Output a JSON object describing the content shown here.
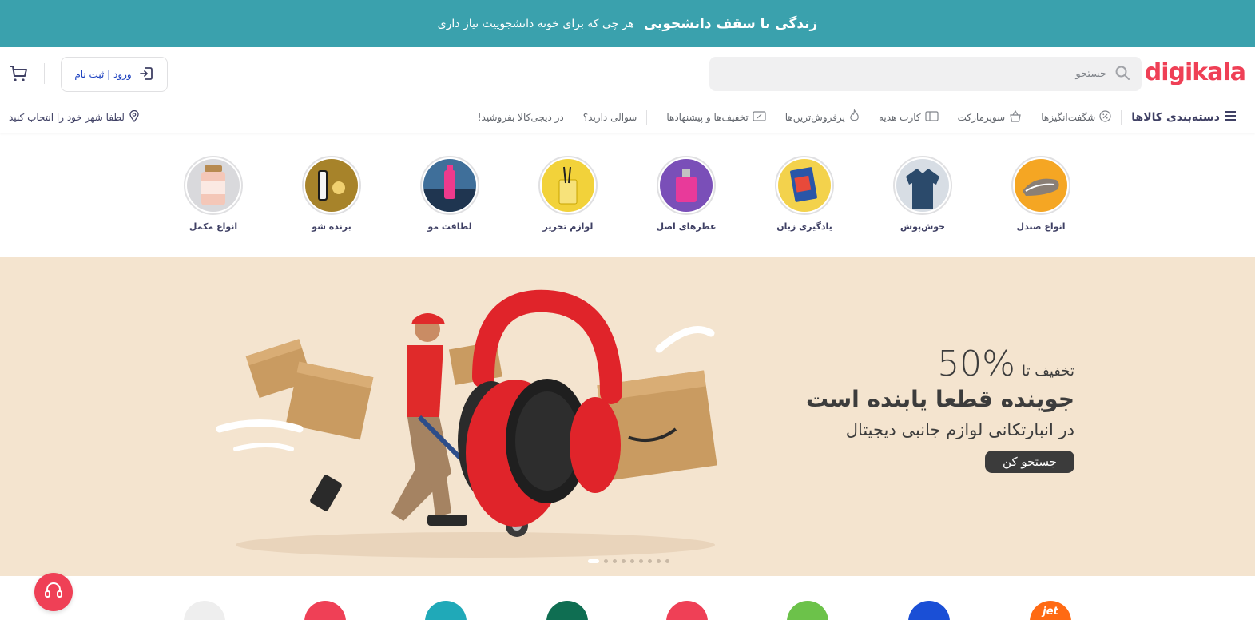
{
  "banner": {
    "title": "زندگی با سقف دانشجویی",
    "subtitle": "هر چی که برای خونه دانشجوییت نیاز داری",
    "background": "#3aa1ad"
  },
  "header": {
    "logo": "digikala",
    "logo_color": "#ef4056",
    "search_placeholder": "جستجو",
    "login_label": "ورود | ثبت نام",
    "icons": {
      "search": "search-icon",
      "login": "login-icon",
      "cart": "cart-icon"
    }
  },
  "nav": {
    "categories_label": "دسته‌بندی کالاها",
    "items": [
      {
        "label": "شگفت‌انگیزها",
        "icon": "percent-icon"
      },
      {
        "label": "سوپرمارکت",
        "icon": "basket-icon"
      },
      {
        "label": "کارت هدیه",
        "icon": "gift-card-icon"
      },
      {
        "label": "پرفروش‌ترین‌ها",
        "icon": "fire-icon"
      },
      {
        "label": "تخفیف‌ها و پیشنهادها",
        "icon": "coupon-icon"
      }
    ],
    "faq": "سوالی دارید؟",
    "sell": "در دیجی‌کالا بفروشید!",
    "city": "لطفا شهر خود را انتخاب کنید"
  },
  "stories": [
    {
      "label": "انواع صندل",
      "color": "#f5a623"
    },
    {
      "label": "خوش‌پوش",
      "color": "#d7dde4"
    },
    {
      "label": "یادگیری زبان",
      "color": "#f3d24c"
    },
    {
      "label": "عطرهای اصل",
      "color": "#7a4fb8"
    },
    {
      "label": "لوازم تحریر",
      "color": "#f2d23a"
    },
    {
      "label": "لطافت مو",
      "color": "#3f6f9a"
    },
    {
      "label": "برنده شو",
      "color": "#a7832a"
    },
    {
      "label": "انواع مکمل",
      "color": "#d9d9dc"
    }
  ],
  "hero": {
    "discount_label": "تخفیف تا",
    "discount_value": "50%",
    "headline": "جوینده قطعا یابنده است",
    "subline": "در انبارتکانی لوازم جانبی دیجیتال",
    "cta": "جستجو کن",
    "background": "#f4e4cf",
    "slides_total": 9,
    "active_slide": 1
  },
  "brands": [
    {
      "name": "jet",
      "color": "#ff6a13"
    },
    {
      "name": "",
      "color": "#1a4fd6"
    },
    {
      "name": "",
      "color": "#6cc24a"
    },
    {
      "name": "",
      "color": "#ef4056"
    },
    {
      "name": "",
      "color": "#0f6e52"
    },
    {
      "name": "",
      "color": "#20a9b8"
    },
    {
      "name": "",
      "color": "#ef4056"
    },
    {
      "name": "",
      "color": "#eeeeee"
    }
  ],
  "support": {
    "icon": "headset-icon",
    "color": "#ef4056"
  }
}
